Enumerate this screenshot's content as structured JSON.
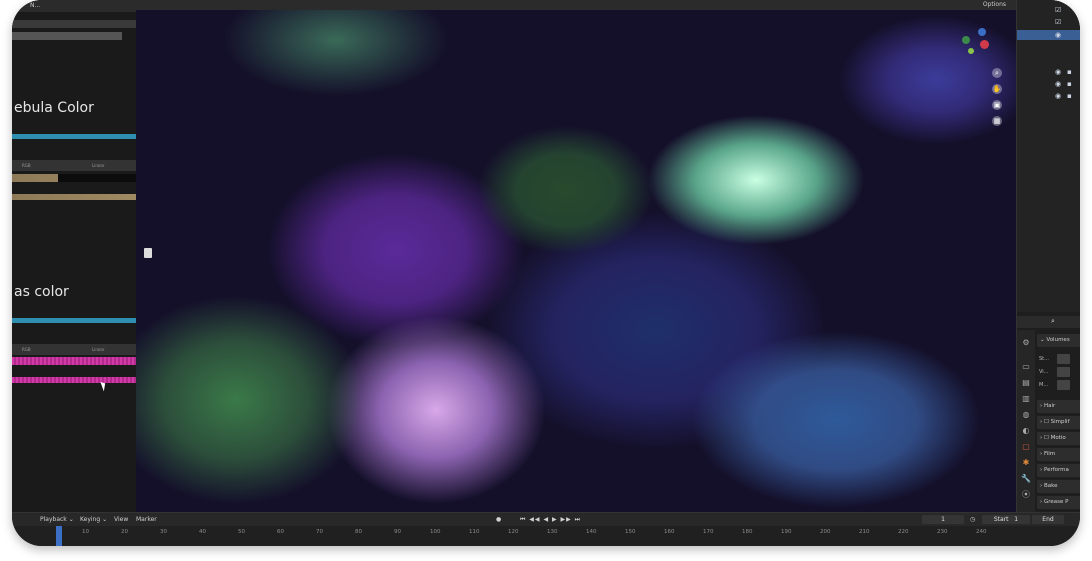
{
  "left_panel": {
    "header_text": "N...",
    "section1_label": "ebula Color",
    "section2_label": "as color",
    "rgb_label": "RGB",
    "interp_label": "Linear"
  },
  "viewport": {
    "header_options": "Options",
    "tool_icons": [
      "zoom-icon",
      "hand-icon",
      "camera-icon",
      "grid-icon"
    ]
  },
  "properties": {
    "search_icon": "search-icon",
    "volumes_label": "Volumes",
    "fields": [
      "St...",
      "Vi...",
      "M..."
    ],
    "panels": [
      "Hair",
      "Simplif",
      "Motio",
      "Film",
      "Performa",
      "Bake",
      "Grease P"
    ]
  },
  "timeline": {
    "menus": [
      "Playback",
      "Keying",
      "View",
      "Marker"
    ],
    "current_frame": "1",
    "start_label": "Start",
    "start_value": "1",
    "end_label": "End",
    "ticks": [
      "10",
      "20",
      "30",
      "40",
      "50",
      "60",
      "70",
      "80",
      "90",
      "100",
      "110",
      "120",
      "130",
      "140",
      "150",
      "160",
      "170",
      "180",
      "190",
      "200",
      "210",
      "220",
      "230",
      "240"
    ]
  },
  "colors": {
    "accent_blue": "#2f8fb0",
    "selection": "#3a5f94",
    "magenta": "#d13aa8"
  }
}
